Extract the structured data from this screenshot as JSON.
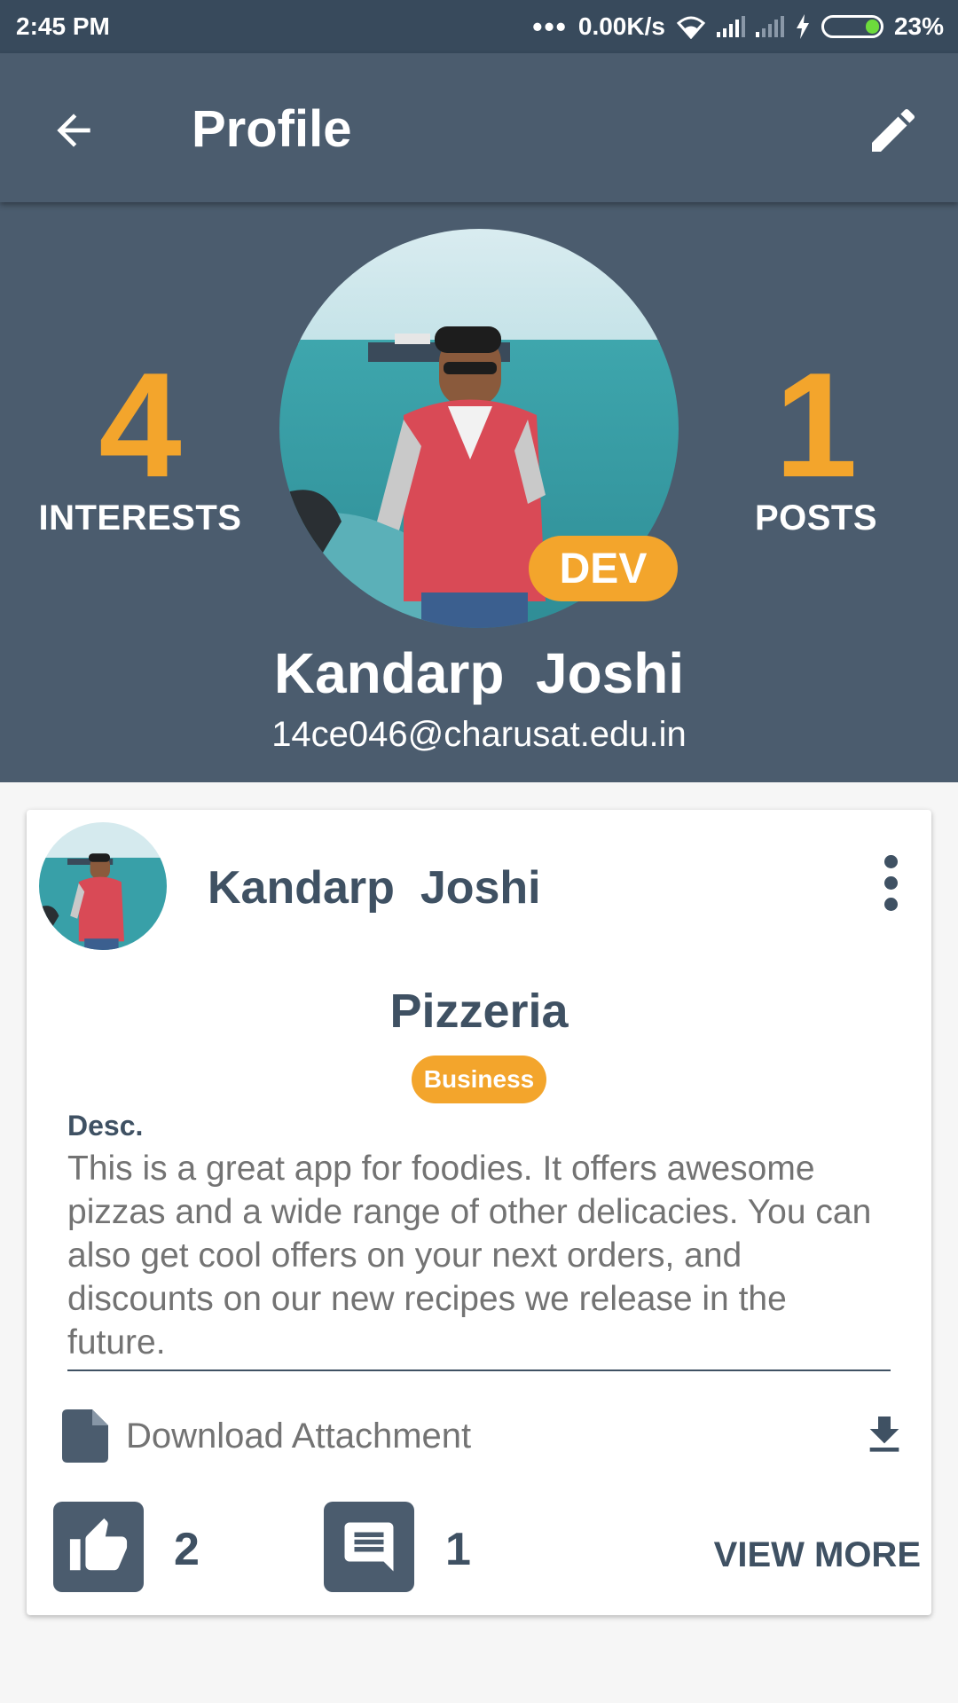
{
  "status_bar": {
    "time": "2:45 PM",
    "network_speed": "0.00K/s",
    "battery_percent": "23%",
    "battery_level": 0.23,
    "icons": [
      "more-dots-icon",
      "wifi-icon",
      "signal-icon",
      "signal-icon",
      "charging-bolt-icon",
      "battery-icon"
    ]
  },
  "app_bar": {
    "title": "Profile",
    "back_icon": "arrow-back-icon",
    "edit_icon": "pencil-edit-icon"
  },
  "profile": {
    "interests_count": "4",
    "interests_label": "INTERESTS",
    "posts_count": "1",
    "posts_label": "POSTS",
    "role_badge": "DEV",
    "name": "Kandarp  Joshi",
    "email": "14ce046@charusat.edu.in"
  },
  "post": {
    "author_name": "Kandarp  Joshi",
    "title": "Pizzeria",
    "category": "Business",
    "desc_label": "Desc.",
    "description": "This is a great app for foodies. It offers awesome pizzas and a wide range of other delicacies. You can also get cool offers on your next orders, and discounts on our new recipes we release in the future.",
    "attachment_label": "Download Attachment",
    "likes": "2",
    "comments": "1",
    "view_more": "VIEW MORE"
  },
  "colors": {
    "primary": "#4b5c6e",
    "status_bar": "#384a5c",
    "accent": "#f3a52c",
    "text_dark": "#3f5163",
    "text_muted": "#737373"
  }
}
